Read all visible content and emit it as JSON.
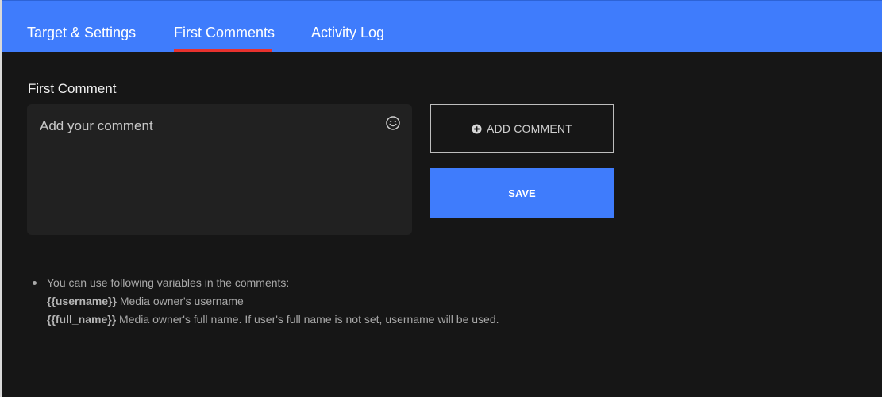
{
  "tabs": [
    {
      "label": "Target & Settings",
      "active": false
    },
    {
      "label": "First Comments",
      "active": true
    },
    {
      "label": "Activity Log",
      "active": false
    }
  ],
  "section": {
    "title": "First Comment"
  },
  "comment": {
    "placeholder": "Add your comment",
    "value": "",
    "emoji_icon": "smiley-icon"
  },
  "buttons": {
    "add_comment_label": "ADD COMMENT",
    "add_comment_icon": "plus-circle-icon",
    "save_label": "SAVE"
  },
  "help": {
    "intro": "You can use following variables in the comments:",
    "variables": [
      {
        "name": "{{username}}",
        "description": " Media owner's username"
      },
      {
        "name": "{{full_name}}",
        "description": " Media owner's full name. If user's full name is not set, username will be used."
      }
    ]
  },
  "colors": {
    "accent": "#3f7cfc",
    "active_tab_indicator": "#e8322e",
    "background": "#161616",
    "panel": "#212121"
  }
}
